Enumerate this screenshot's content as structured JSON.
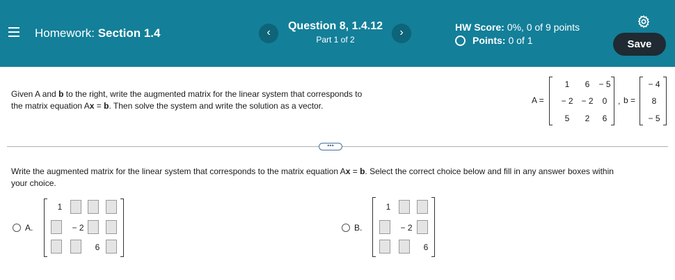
{
  "header": {
    "title_prefix": "Homework:",
    "title_section": "Section 1.4",
    "question_title": "Question 8, 1.4.12",
    "question_part": "Part 1 of 2",
    "prev_label": "‹",
    "next_label": "›",
    "hw_score_label": "HW Score:",
    "hw_score_value": "0%, 0 of 9 points",
    "points_label": "Points:",
    "points_value": "0 of 1",
    "save_label": "Save",
    "colors": {
      "bar": "#137f99",
      "save": "#1f2a32"
    }
  },
  "problem": {
    "line1_a": "Given A and ",
    "line1_b": "b",
    "line1_c": " to the right, write the augmented matrix for the linear system that corresponds to",
    "line2_a": "the matrix equation A",
    "line2_x": "x",
    "line2_eq": " = ",
    "line2_b": "b",
    "line2_c": ". Then solve the system and write the solution as a vector.",
    "A_label": "A =",
    "b_label": "b =",
    "separator": ",",
    "A": [
      [
        "1",
        "6",
        "− 5"
      ],
      [
        "− 2",
        "− 2",
        "0"
      ],
      [
        "5",
        "2",
        "6"
      ]
    ],
    "b": [
      "− 4",
      "8",
      "− 5"
    ]
  },
  "more_label": "•••",
  "instruction": {
    "text_a": "Write the augmented matrix for the linear system that corresponds to the matrix equation A",
    "text_x": "x",
    "text_eq": " = ",
    "text_b": "b",
    "text_c": ". Select the correct choice below and fill in any answer boxes within",
    "text_d": "your choice."
  },
  "choices": [
    {
      "label": "A.",
      "given": [
        "1",
        "− 2",
        "6"
      ]
    },
    {
      "label": "B.",
      "given": [
        "1",
        "− 2",
        "6"
      ]
    }
  ]
}
